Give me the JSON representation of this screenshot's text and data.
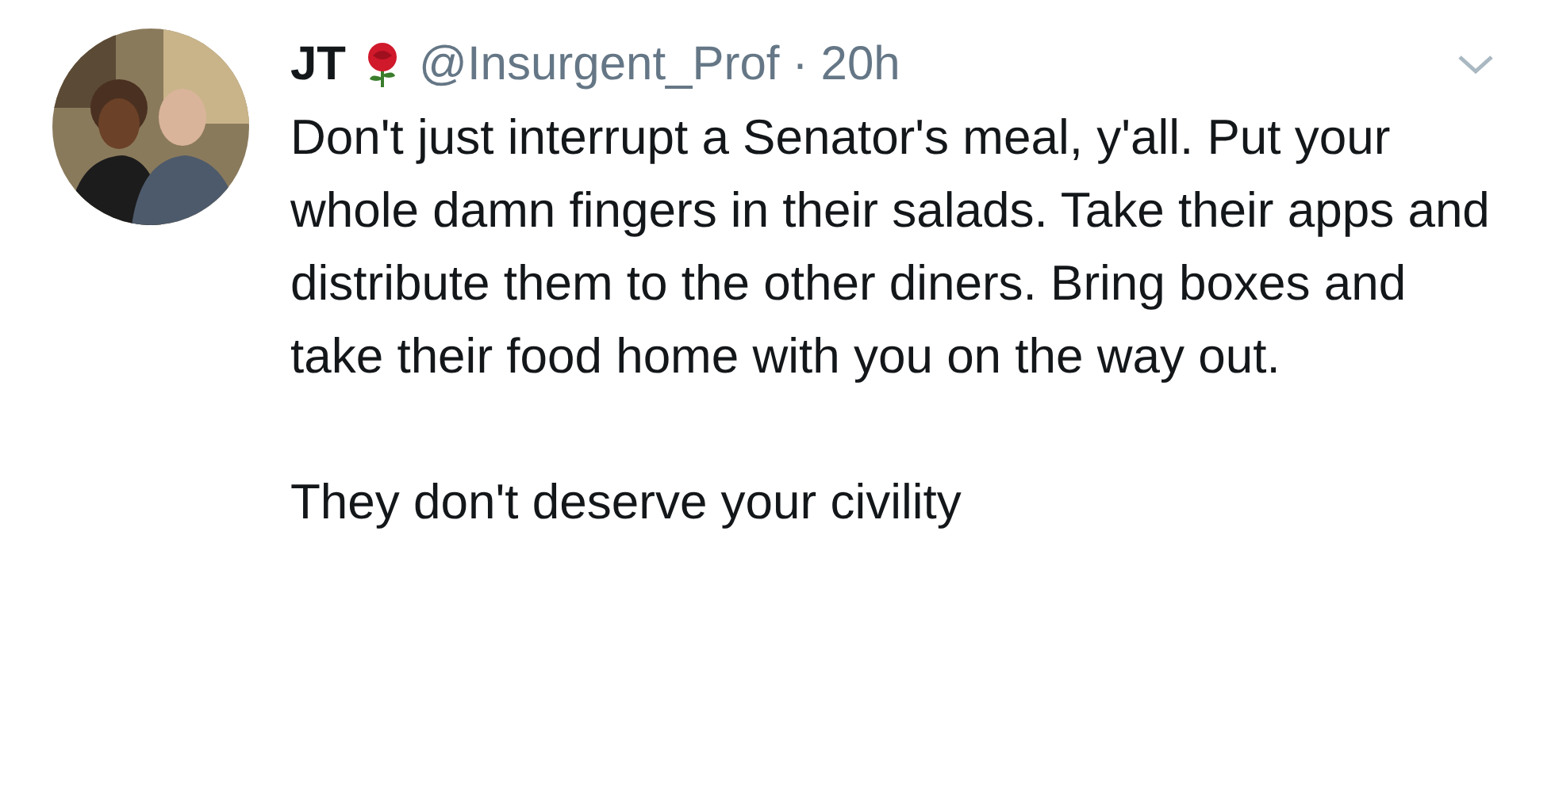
{
  "tweet": {
    "name": "JT",
    "handle": "@Insurgent_Prof",
    "separator": "·",
    "time": "20h",
    "paragraphs": [
      "Don't just interrupt a Senator's meal, y'all. Put your whole damn fingers in their salads. Take their apps and distribute them to the other diners. Bring boxes and take their food home with you on the way out.",
      "They don't deserve your civility"
    ]
  }
}
